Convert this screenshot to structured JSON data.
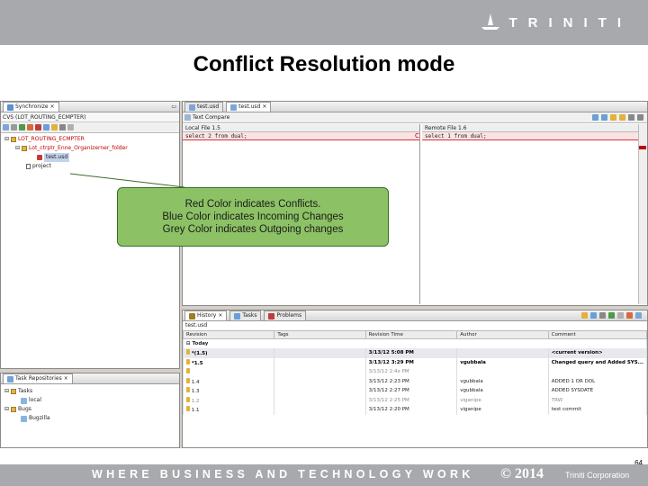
{
  "header": {
    "logo_text": "TRINITI"
  },
  "slide": {
    "title": "Conflict Resolution mode",
    "page_number": "64"
  },
  "callout": {
    "line1": "Red Color indicates Conflicts.",
    "line2": "Blue Color indicates Incoming Changes",
    "line3": "Grey Color indicates Outgoing changes"
  },
  "sync_view": {
    "tab_label": "Synchronize",
    "title_text": "CVS (LOT_ROUTING_ECMPTER)",
    "tree": [
      {
        "label": "LOT_ROUTING_ECMPTER",
        "depth": 1,
        "conflict": true
      },
      {
        "label": "Lot_ctrptr_Enne_Organizerner_folder",
        "depth": 2,
        "conflict": true
      },
      {
        "label": "test.usd",
        "depth": 3,
        "conflict": false,
        "selected": true
      },
      {
        "label": "project",
        "depth": 2,
        "conflict": false
      }
    ]
  },
  "task_view": {
    "tab_label": "Task Repositories",
    "items": [
      {
        "label": "Tasks",
        "depth": 1
      },
      {
        "label": "local",
        "depth": 2
      },
      {
        "label": "Bugs",
        "depth": 1
      },
      {
        "label": "Bugzilla",
        "depth": 2
      }
    ]
  },
  "editor": {
    "tabs": [
      "test.usd",
      "test.usd"
    ],
    "compare_label": "Text Compare",
    "local_label": "Local File 1.5",
    "remote_label": "Remote File 1.6",
    "local_code": "select 2 from dual;",
    "remote_code": "select 1 from dual;"
  },
  "history": {
    "tabs": [
      "History",
      "Tasks",
      "Problems"
    ],
    "path": "test.usd",
    "columns": [
      "Revision",
      "Tags",
      "Revision Time",
      "Author",
      "Comment"
    ],
    "group_label": "Today",
    "rows": [
      {
        "revision": "*(1.5)",
        "tags": "",
        "time": "3/13/12 5:08 PM",
        "author": "",
        "comment": "<current version>",
        "style": "bold hl"
      },
      {
        "revision": "*1.5",
        "tags": "",
        "time": "3/13/12 3:29 PM",
        "author": "vgubbala",
        "comment": "Changed query and Added SYS...",
        "style": "bold"
      },
      {
        "revision": "",
        "tags": "",
        "time": "3/13/12 2:4x PM",
        "author": "",
        "comment": "",
        "style": "grey"
      },
      {
        "revision": "1.4",
        "tags": "",
        "time": "3/13/12 2:23 PM",
        "author": "vgubbala",
        "comment": "ADDED 1 OR DOL",
        "style": ""
      },
      {
        "revision": "1.3",
        "tags": "",
        "time": "3/13/12 2:27 PM",
        "author": "vgubbala",
        "comment": "ADDED SYSDATE",
        "style": ""
      },
      {
        "revision": "1.2",
        "tags": "",
        "time": "3/13/12 2:25 PM",
        "author": "viganipe",
        "comment": "TRW",
        "style": "grey"
      },
      {
        "revision": "1.1",
        "tags": "",
        "time": "3/13/12 2:20 PM",
        "author": "viganipe",
        "comment": "test commit",
        "style": ""
      }
    ]
  },
  "footer": {
    "tagline": "WHERE BUSINESS AND TECHNOLOGY WORK",
    "copyright": "© 2014",
    "corporation": "Triniti Corporation"
  },
  "colors": {
    "bar_grey": "#a7a9ac",
    "callout_green": "#8cc265",
    "conflict_red": "#c00000"
  }
}
